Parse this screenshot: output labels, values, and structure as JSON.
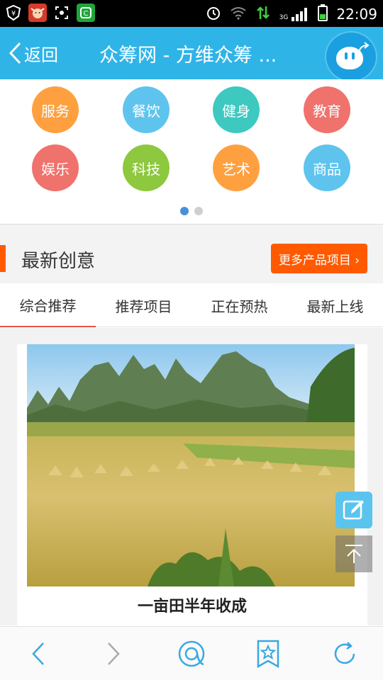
{
  "status_bar": {
    "time": "22:09",
    "network": "3G",
    "icons": [
      "yen-shield-icon",
      "bull-app-icon",
      "screenshot-icon",
      "green-app-icon",
      "alarm-icon",
      "wifi-icon",
      "data-arrows-icon",
      "signal-icon",
      "battery-icon"
    ]
  },
  "nav": {
    "back_label": "返回",
    "title": "众筹网 - 方维众筹 ..."
  },
  "categories": [
    {
      "label": "服务",
      "color": "#ffa040"
    },
    {
      "label": "餐饮",
      "color": "#5ec4ee"
    },
    {
      "label": "健身",
      "color": "#3dc8c0"
    },
    {
      "label": "教育",
      "color": "#f0726c"
    },
    {
      "label": "娱乐",
      "color": "#f0726c"
    },
    {
      "label": "科技",
      "color": "#8dc83e"
    },
    {
      "label": "艺术",
      "color": "#ffa040"
    },
    {
      "label": "商品",
      "color": "#5ec4ee"
    }
  ],
  "section": {
    "title": "最新创意",
    "more_label": "更多产品项目 ›"
  },
  "tabs": [
    {
      "label": "综合推荐",
      "active": true
    },
    {
      "label": "推荐项目",
      "active": false
    },
    {
      "label": "正在预热",
      "active": false
    },
    {
      "label": "最新上线",
      "active": false
    }
  ],
  "card": {
    "title": "一亩田半年收成"
  },
  "colors": {
    "nav_bg": "#2fb4e8",
    "accent": "#ff5a00",
    "tab_active_underline": "#e8514a"
  }
}
